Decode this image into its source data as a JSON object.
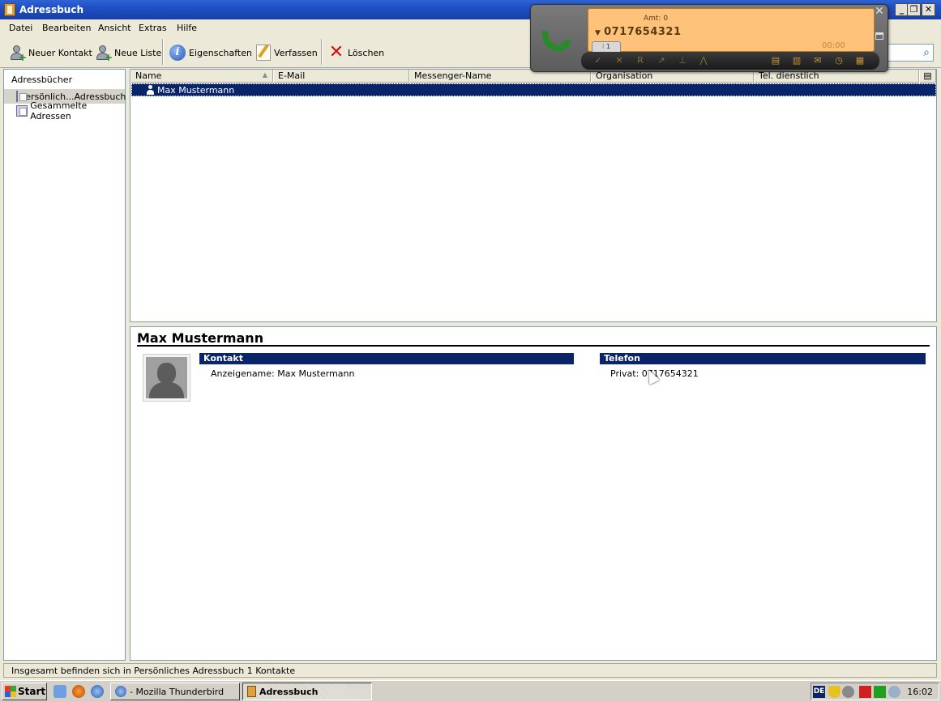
{
  "window": {
    "title": "Adressbuch"
  },
  "menu": [
    "Datei",
    "Bearbeiten",
    "Ansicht",
    "Extras",
    "Hilfe"
  ],
  "toolbar": {
    "new_contact": "Neuer Kontakt",
    "new_list": "Neue Liste",
    "properties": "Eigenschaften",
    "compose": "Verfassen",
    "delete": "Löschen"
  },
  "sidebar": {
    "header": "Adressbücher",
    "items": [
      {
        "label": "Persönlich...Adressbuch",
        "selected": true
      },
      {
        "label": "Gesammelte Adressen",
        "selected": false
      }
    ]
  },
  "list": {
    "columns": [
      "Name",
      "E-Mail",
      "Messenger-Name",
      "Organisation",
      "Tel. dienstlich"
    ],
    "rows": [
      {
        "name": "Max Mustermann",
        "selected": true
      }
    ]
  },
  "detail": {
    "name": "Max Mustermann",
    "contact_header": "Kontakt",
    "display_name": "Anzeigename: Max Mustermann",
    "phone_header": "Telefon",
    "private_phone": "Privat: 0717654321"
  },
  "status": {
    "text": "Insgesamt befinden sich in Persönliches Adressbuch 1 Kontakte"
  },
  "phone_widget": {
    "amt": "Amt: 0",
    "number": "0717654321",
    "timer": "00:00",
    "line_tab": "1"
  },
  "taskbar": {
    "start": "Start",
    "tasks": [
      {
        "label": "- Mozilla Thunderbird",
        "active": false
      },
      {
        "label": "Adressbuch",
        "active": true
      }
    ],
    "tray_lang": "DE",
    "clock": "16:02"
  },
  "colors": {
    "selection": "#0a246a",
    "titlebar": "#1f4fc4",
    "phone_display": "#ffc27a"
  }
}
